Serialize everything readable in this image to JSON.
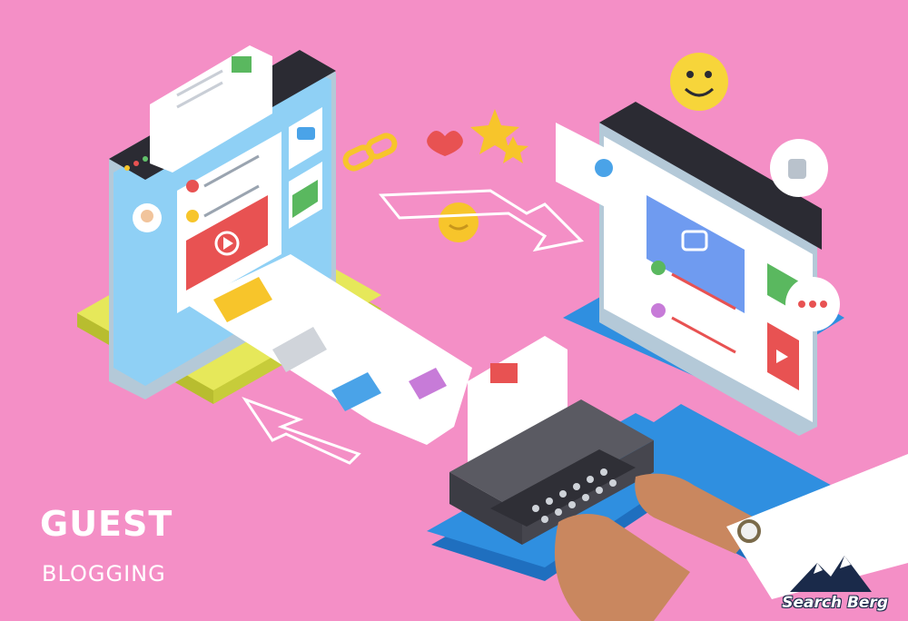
{
  "headline": "GUEST",
  "subheadline": "BLOGGING",
  "brand": "Search Berg",
  "colors": {
    "background": "#f48fc6",
    "left_screen": "#8fd0f5",
    "left_base": "#e6e85a",
    "right_base": "#2f8fe0",
    "accent_red": "#e85252",
    "accent_yellow": "#f7c52b"
  },
  "icons": [
    "camera-icon",
    "play-icon",
    "link-icon",
    "heart-icon",
    "star-icon",
    "smiley-icon",
    "thumbs-up-icon",
    "chat-icon",
    "typewriter-icon",
    "arrow-right-icon",
    "arrow-left-icon"
  ]
}
